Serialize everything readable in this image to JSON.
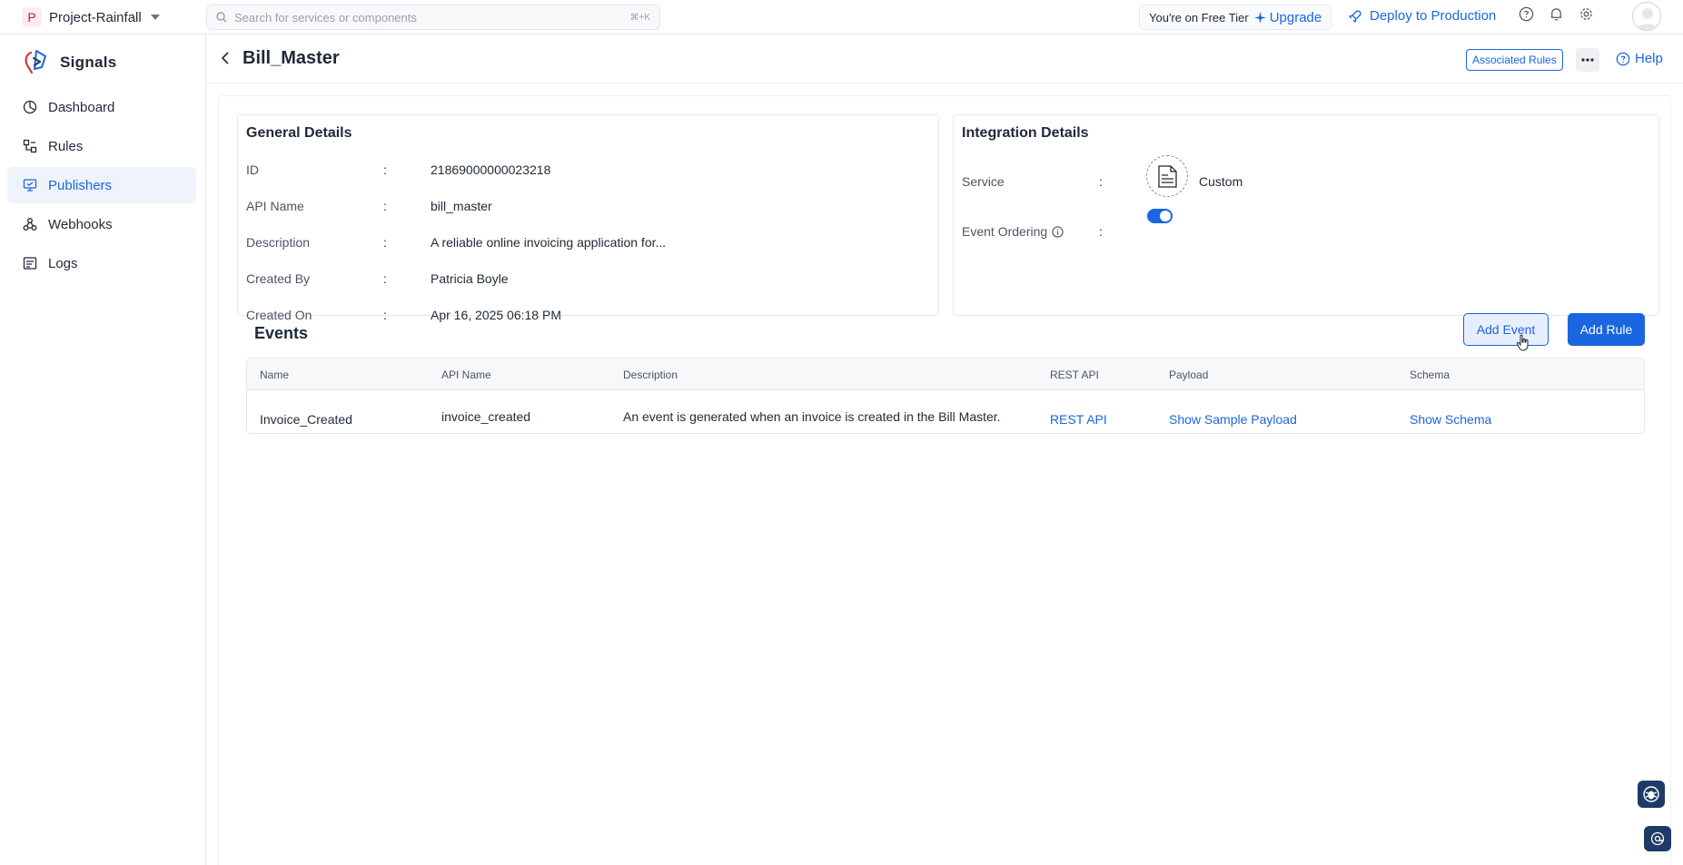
{
  "topbar": {
    "project_initial": "P",
    "project_name": "Project-Rainfall",
    "search_placeholder": "Search for services or components",
    "search_shortcut": "⌘+K",
    "tier_text": "You're on Free Tier",
    "upgrade_label": "Upgrade",
    "deploy_label": "Deploy to Production"
  },
  "sidebar": {
    "brand": "Signals",
    "items": [
      {
        "label": "Dashboard",
        "icon": "dashboard-icon"
      },
      {
        "label": "Rules",
        "icon": "rules-icon"
      },
      {
        "label": "Publishers",
        "icon": "publishers-icon",
        "active": true
      },
      {
        "label": "Webhooks",
        "icon": "webhooks-icon"
      },
      {
        "label": "Logs",
        "icon": "logs-icon"
      }
    ]
  },
  "header": {
    "title": "Bill_Master",
    "associated_rules_label": "Associated Rules",
    "help_label": "Help"
  },
  "general": {
    "title": "General Details",
    "rows": [
      {
        "label": "ID",
        "value": "21869000000023218"
      },
      {
        "label": "API Name",
        "value": "bill_master"
      },
      {
        "label": "Description",
        "value": "A reliable online invoicing application for..."
      },
      {
        "label": "Created By",
        "value": "Patricia Boyle"
      },
      {
        "label": "Created On",
        "value": "Apr 16, 2025 06:18 PM"
      }
    ],
    "separator": ":"
  },
  "integration": {
    "title": "Integration Details",
    "service_label": "Service",
    "service_value": "Custom",
    "event_ordering_label": "Event Ordering",
    "event_ordering_enabled": true
  },
  "events": {
    "title": "Events",
    "add_event_label": "Add Event",
    "add_rule_label": "Add Rule",
    "columns": [
      "Name",
      "API Name",
      "Description",
      "REST API",
      "Payload",
      "Schema"
    ],
    "rows": [
      {
        "name": "Invoice_Created",
        "api_name": "invoice_created",
        "description": "An event is generated when an invoice is created in the Bill Master.",
        "rest_api": "REST API",
        "payload": "Show Sample Payload",
        "schema": "Show Schema"
      }
    ]
  },
  "colors": {
    "accent": "#1a66e0",
    "active_bg": "#eef3fc",
    "fab": "#1f3a66"
  }
}
